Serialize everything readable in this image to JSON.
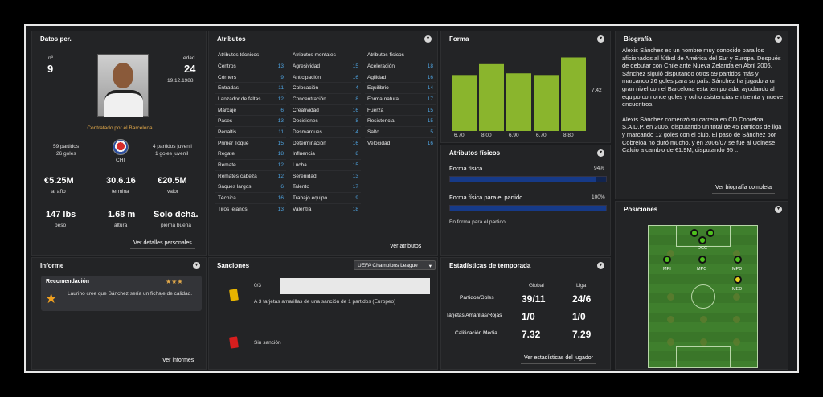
{
  "personal": {
    "title": "Datos per.",
    "number_label": "nº",
    "number": "9",
    "age_label": "edad",
    "age": "24",
    "dob": "19.12.1988",
    "contract": "Contratado por el Barcelona",
    "matches": "59 partidos",
    "goals": "26 goles",
    "youth_matches": "4 partidos juvenil",
    "youth_goals": "1 goles juvenil",
    "nation": "CHI",
    "wage": "€5.25M",
    "wage_label": "al año",
    "expires": "30.6.16",
    "expires_label": "termina",
    "value": "€20.5M",
    "value_label": "valor",
    "weight": "147 lbs",
    "weight_label": "peso",
    "height": "1.68 m",
    "height_label": "altura",
    "foot": "Solo dcha.",
    "foot_label": "pierna buena",
    "link": "Ver detalles personales"
  },
  "attributes": {
    "title": "Atributos",
    "link": "Ver atributos",
    "technical": {
      "title": "Atributos técnicos",
      "rows": [
        [
          "Centros",
          "13"
        ],
        [
          "Córners",
          "9"
        ],
        [
          "Entradas",
          "11"
        ],
        [
          "Lanzador de faltas",
          "12"
        ],
        [
          "Marcaje",
          "6"
        ],
        [
          "Pases",
          "13"
        ],
        [
          "Penaltis",
          "11"
        ],
        [
          "Primer Toque",
          "15"
        ],
        [
          "Regate",
          "18"
        ],
        [
          "Remate",
          "12"
        ],
        [
          "Remates cabeza",
          "12"
        ],
        [
          "Saques largos",
          "6"
        ],
        [
          "Técnica",
          "16"
        ],
        [
          "Tiros lejanos",
          "13"
        ]
      ]
    },
    "mental": {
      "title": "Atributos mentales",
      "rows": [
        [
          "Agresividad",
          "15"
        ],
        [
          "Anticipación",
          "16"
        ],
        [
          "Colocación",
          "4"
        ],
        [
          "Concentración",
          "8"
        ],
        [
          "Creatividad",
          "16"
        ],
        [
          "Decisiones",
          "8"
        ],
        [
          "Desmarques",
          "14"
        ],
        [
          "Determinación",
          "16"
        ],
        [
          "Influencia",
          "8"
        ],
        [
          "Lucha",
          "15"
        ],
        [
          "Serenidad",
          "13"
        ],
        [
          "Talento",
          "17"
        ],
        [
          "Trabajo equipo",
          "9"
        ],
        [
          "Valentía",
          "18"
        ]
      ]
    },
    "physical": {
      "title": "Atributos físicos",
      "rows": [
        [
          "Aceleración",
          "18"
        ],
        [
          "Agilidad",
          "16"
        ],
        [
          "Equilibrio",
          "14"
        ],
        [
          "Forma natural",
          "17"
        ],
        [
          "Fuerza",
          "15"
        ],
        [
          "Resistencia",
          "15"
        ],
        [
          "Salto",
          "5"
        ],
        [
          "Velocidad",
          "16"
        ]
      ]
    }
  },
  "form": {
    "title": "Forma",
    "average": "7.42",
    "chart_data": {
      "type": "bar",
      "categories": [
        "1",
        "2",
        "3",
        "4",
        "5"
      ],
      "values": [
        6.7,
        8.0,
        6.9,
        6.7,
        8.8
      ],
      "labels": [
        "6.70",
        "8.00",
        "6.90",
        "6.70",
        "8.80"
      ],
      "ylim": [
        0,
        10
      ]
    }
  },
  "fitness": {
    "title": "Atributos físicos",
    "bar1_label": "Forma física",
    "bar1_pct": "94%",
    "bar1_value": 0.94,
    "bar2_label": "Forma física para el partido",
    "bar2_pct": "100%",
    "bar2_value": 1.0,
    "status": "En forma para el partido"
  },
  "biography": {
    "title": "Biografía",
    "p1": "Alexis Sánchez es un nombre muy conocido para los aficionados al fútbol de América del Sur y Europa. Después de debutar con Chile ante Nueva Zelanda en Abril 2006, Sánchez siguió disputando otros 59 partidos más y marcando 26 goles para su país. Sánchez ha jugado a un gran nivel con el Barcelona esta temporada, ayudando al equipo con once goles y ocho asistencias en treinta y nueve encuentros.",
    "p2": "Alexis Sánchez comenzó su carrera en CD Cobreloa S.A.D.P. en 2005, disputando un total de 45 partidos de liga y marcando 12 goles con el club. El paso de Sánchez por Cobreloa no duró mucho, y en 2006/07 se fue al Udinese Calcio a cambio de €1.9M, disputando 95 ..",
    "link": "Ver biografía completa"
  },
  "positions": {
    "title": "Posiciones",
    "labels": {
      "dcc": "DCC",
      "mpi": "MPI",
      "mpc": "MPC",
      "mpd": "MPD",
      "med": "MED"
    }
  },
  "report": {
    "title": "Informe",
    "card_title": "Recomendación",
    "stars": "★★★",
    "text": "Laurino cree que Sánchez sería un fichaje de calidad.",
    "link": "Ver informes"
  },
  "sanctions": {
    "title": "Sanciones",
    "competition": "UEFA Champions League",
    "count": "0/3",
    "yellow_text": "A 3 tarjetas amarillas de una sanción de 1 partidos (Europeo)",
    "red_text": "Sin sanción"
  },
  "season": {
    "title": "Estadísticas de temporada",
    "col1": "Global",
    "col2": "Liga",
    "rows": [
      [
        "Partidos/Goles",
        "39/11",
        "24/6"
      ],
      [
        "Tarjetas Amarillas/Rojas",
        "1/0",
        "1/0"
      ],
      [
        "Calificación Media",
        "7.32",
        "7.29"
      ]
    ],
    "link": "Ver estadísticas del jugador"
  },
  "colors": {
    "accent": "#8ab52d",
    "gold": "#e1a84a",
    "blue": "#4ea3e0"
  }
}
